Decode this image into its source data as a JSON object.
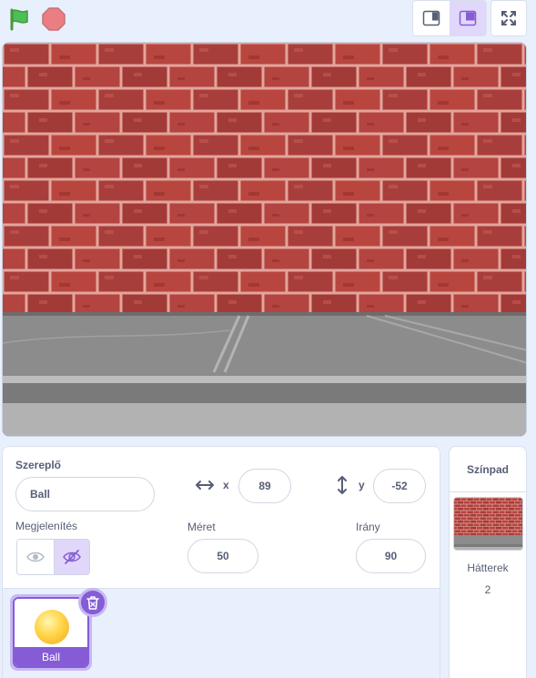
{
  "controls": {
    "green_flag_icon": "green-flag-icon",
    "stop_icon": "stop-icon",
    "small_stage_icon": "small-stage-icon",
    "normal_stage_icon": "normal-stage-icon",
    "fullscreen_icon": "fullscreen-icon"
  },
  "sprite": {
    "label": "Szereplő",
    "name": "Ball",
    "x_label": "x",
    "x": "89",
    "y_label": "y",
    "y": "-52",
    "show_label": "Megjelenítés",
    "size_label": "Méret",
    "size": "50",
    "direction_label": "Irány",
    "direction": "90"
  },
  "sprite_list": [
    {
      "name": "Ball",
      "selected": true
    }
  ],
  "stage_panel": {
    "title": "Színpad",
    "backdrops_label": "Hátterek",
    "backdrops_count": "2"
  },
  "colors": {
    "accent": "#855cd6",
    "flag": "#4cbf56",
    "stop": "#ec5959",
    "background": "#e9f0fd"
  }
}
